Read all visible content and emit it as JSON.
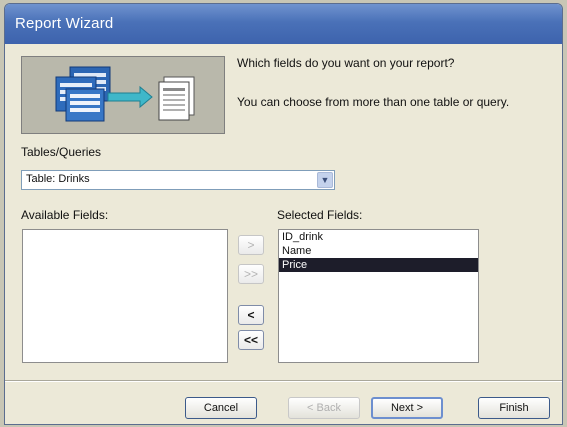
{
  "window": {
    "title": "Report Wizard"
  },
  "prompt": {
    "question": "Which fields do you want on your report?",
    "hint": "You can choose from more than one table or query."
  },
  "tables_queries": {
    "label": "Tables/Queries",
    "selected": "Table: Drinks"
  },
  "available_fields": {
    "label": "Available Fields:",
    "items": []
  },
  "selected_fields": {
    "label": "Selected Fields:",
    "items": [
      "ID_drink",
      "Name",
      "Price"
    ],
    "highlighted": "Price"
  },
  "move_buttons": {
    "add_one": ">",
    "add_all": ">>",
    "remove_one": "<",
    "remove_all": "<<"
  },
  "buttons": {
    "cancel": "Cancel",
    "back": "< Back",
    "next": "Next >",
    "finish": "Finish"
  },
  "colors": {
    "titlebar": "#4a71b8",
    "dialog_bg": "#ece9d8",
    "selection": "#1d1d2a",
    "illustration_arrow": "#3fb7c9"
  }
}
